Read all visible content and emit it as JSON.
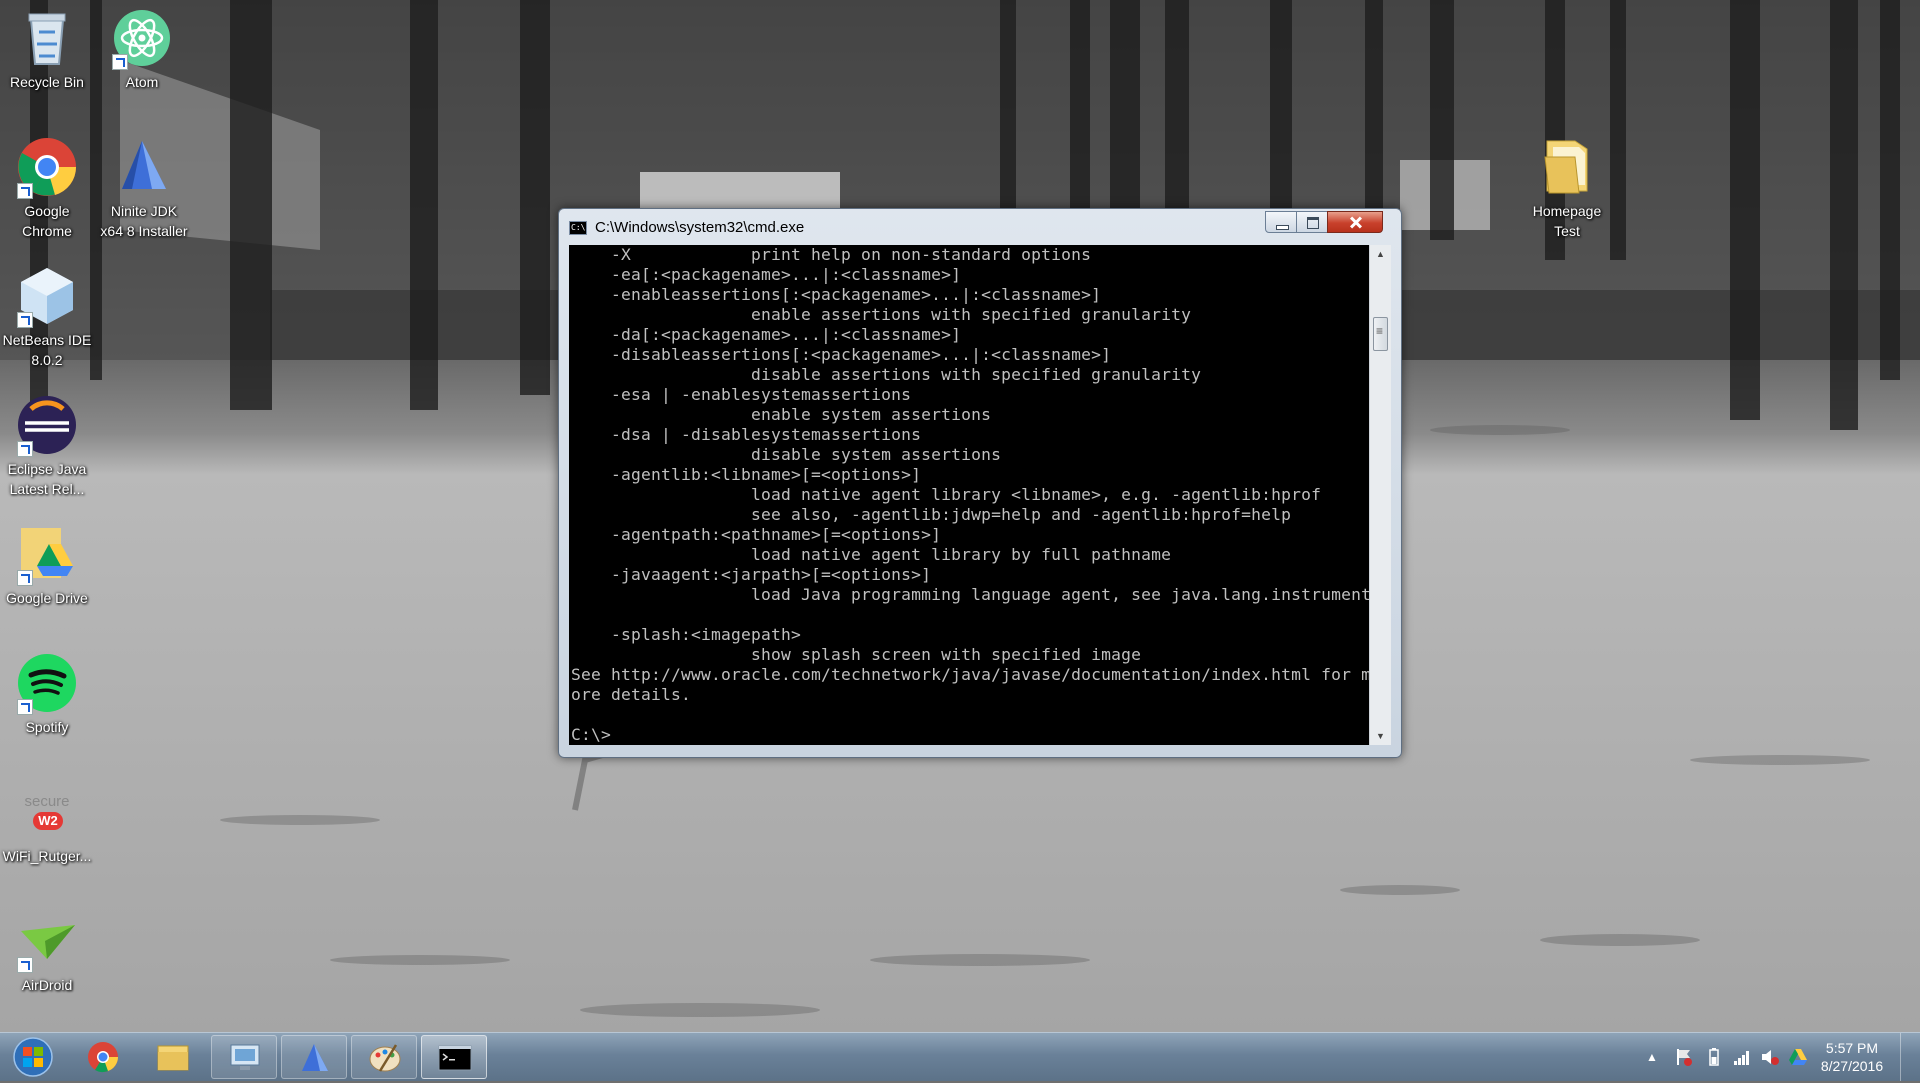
{
  "desktop": {
    "icons": [
      {
        "label": "Recycle Bin"
      },
      {
        "label": "Atom"
      },
      {
        "label": "Google\nChrome"
      },
      {
        "label": "Ninite JDK\nx64 8 Installer"
      },
      {
        "label": "NetBeans IDE\n8.0.2"
      },
      {
        "label": "Eclipse Java\nLatest Rel..."
      },
      {
        "label": "Google Drive"
      },
      {
        "label": "Spotify"
      },
      {
        "label": "WiFi_Rutger..."
      },
      {
        "label": "AirDroid"
      },
      {
        "label": "Homepage\nTest"
      }
    ],
    "secure_w2_logo": {
      "text": "secure",
      "badge": "W2"
    }
  },
  "cmd_window": {
    "title": "C:\\Windows\\system32\\cmd.exe",
    "icon_text": "C:\\",
    "lines": [
      "    -X            print help on non-standard options",
      "    -ea[:<packagename>...|:<classname>]",
      "    -enableassertions[:<packagename>...|:<classname>]",
      "                  enable assertions with specified granularity",
      "    -da[:<packagename>...|:<classname>]",
      "    -disableassertions[:<packagename>...|:<classname>]",
      "                  disable assertions with specified granularity",
      "    -esa | -enablesystemassertions",
      "                  enable system assertions",
      "    -dsa | -disablesystemassertions",
      "                  disable system assertions",
      "    -agentlib:<libname>[=<options>]",
      "                  load native agent library <libname>, e.g. -agentlib:hprof",
      "                  see also, -agentlib:jdwp=help and -agentlib:hprof=help",
      "    -agentpath:<pathname>[=<options>]",
      "                  load native agent library by full pathname",
      "    -javaagent:<jarpath>[=<options>]",
      "                  load Java programming language agent, see java.lang.instrument",
      "",
      "    -splash:<imagepath>",
      "                  show splash screen with specified image",
      "See http://www.oracle.com/technetwork/java/javase/documentation/index.html for m",
      "ore details.",
      "",
      "C:\\>"
    ]
  },
  "taskbar": {
    "clock_time": "5:57 PM",
    "clock_date": "8/27/2016",
    "pinned": [
      "start-orb",
      "chrome",
      "file-explorer",
      "control-panel",
      "ninite",
      "paint",
      "cmd"
    ]
  },
  "colors": {
    "console_bg": "#000000",
    "console_fg": "#c0c0c0",
    "close_button": "#c8412c",
    "taskbar": "#6a8199"
  }
}
